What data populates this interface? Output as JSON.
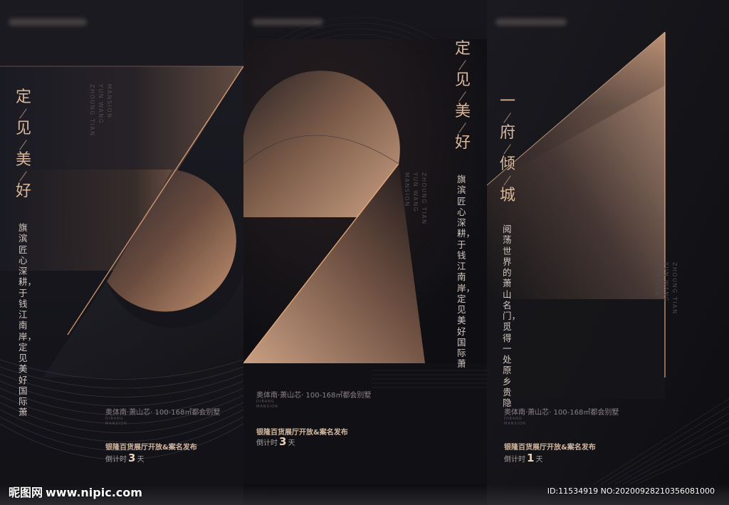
{
  "panels": [
    {
      "title_chars": [
        "定",
        "见",
        "美",
        "好"
      ],
      "body_text": "旗滨匠心深耕，于钱江南岸，定见美好国际萧",
      "latin": [
        "ZHOUNG TIAN",
        "YUN WANG",
        "MANSION"
      ],
      "info_line": "奥体南·萧山芯· 100-168㎡都会别墅",
      "logo_text": [
        "DIBANG",
        "MANSION"
      ],
      "event_line": "银隆百货展厅开放&案名发布",
      "countdown_prefix": "倒计时",
      "countdown_number": "3",
      "countdown_suffix": "天"
    },
    {
      "title_chars": [
        "定",
        "见",
        "美",
        "好"
      ],
      "body_text": "旗滨匠心深耕，于钱江南岸，定见美好国际萧",
      "latin": [
        "ZHOUNG TIAN",
        "YUN WANG",
        "MANSION"
      ],
      "info_line": "奥体南·萧山芯· 100-168㎡都会别墅",
      "logo_text": [
        "DIBANG",
        "MANSION"
      ],
      "event_line": "银隆百货展厅开放&案名发布",
      "countdown_prefix": "倒计时",
      "countdown_number": "3",
      "countdown_suffix": "天"
    },
    {
      "title_chars": [
        "一",
        "府",
        "倾",
        "城"
      ],
      "body_text": "阅荡世界的萧山名门，觅得一处原乡贵隐",
      "latin": [
        "ZHOUNG TIAN",
        "YUN WANG",
        "MANSION"
      ],
      "info_line": "奥体南·萧山芯· 100-168㎡都会别墅",
      "logo_text": [
        "DIBANG",
        "MANSION"
      ],
      "event_line": "银隆百货展厅开放&案名发布",
      "countdown_prefix": "倒计时",
      "countdown_number": "1",
      "countdown_suffix": "天"
    }
  ],
  "watermark": {
    "brand": "昵图网",
    "site": "www.nipic.com",
    "id_line": "ID:11534919 NO:20200928210356081000"
  },
  "colors": {
    "gold": "#d9b79a",
    "copper": "#c8926a",
    "background": "#0e0e12"
  }
}
